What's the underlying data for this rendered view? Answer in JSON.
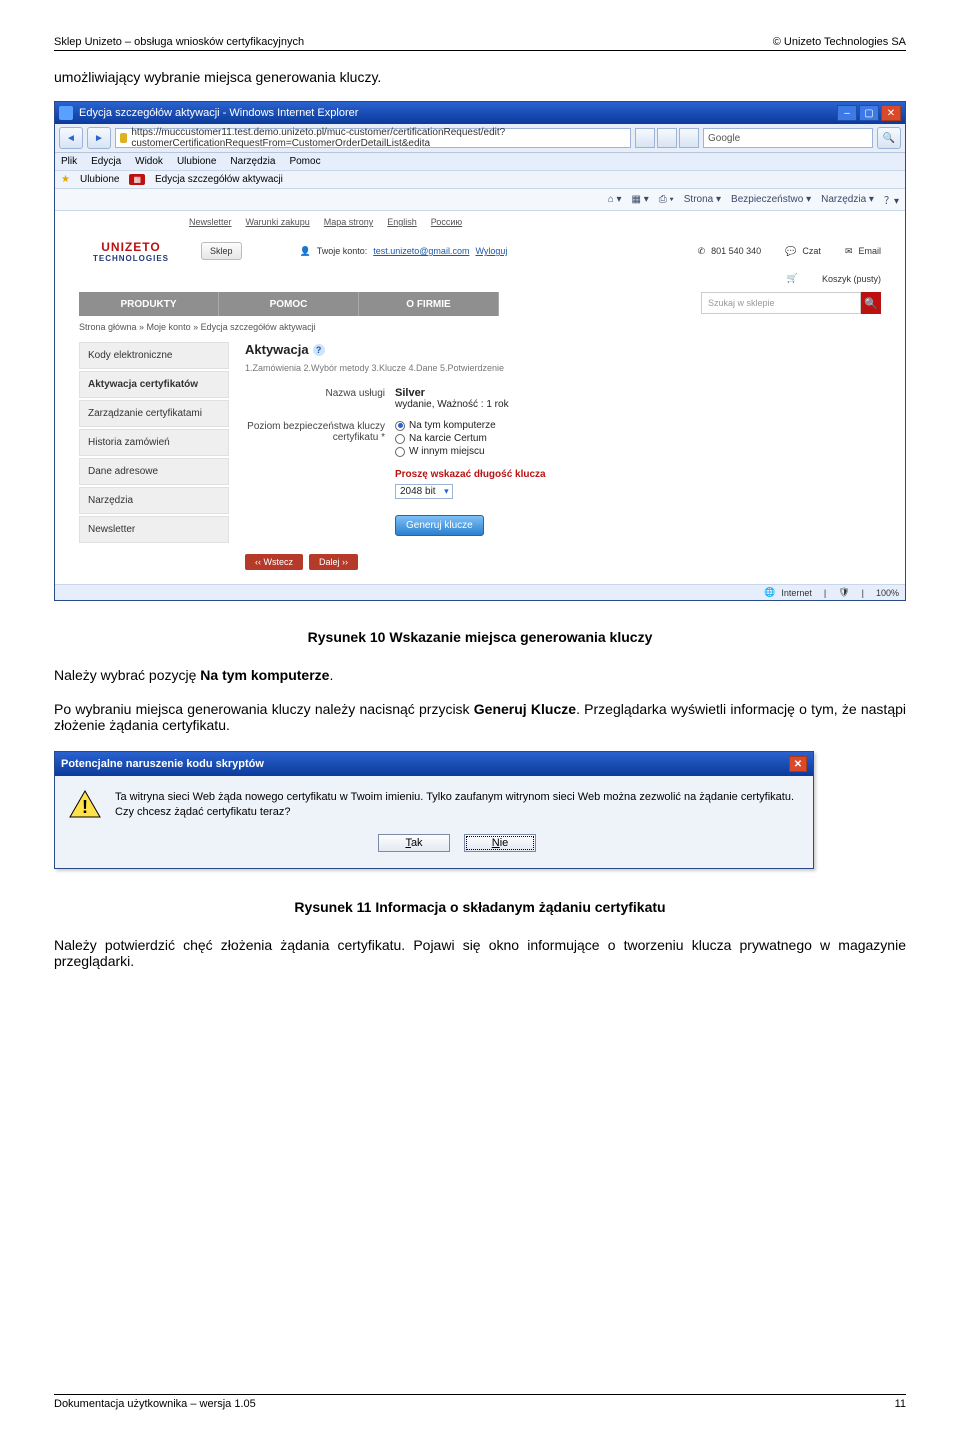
{
  "doc": {
    "header_left": "Sklep Unizeto – obsługa wniosków certyfikacyjnych",
    "header_right": "© Unizeto Technologies SA",
    "footer_left": "Dokumentacja użytkownika – wersja 1.05",
    "footer_right": "11"
  },
  "intro": "umożliwiający wybranie miejsca generowania kluczy.",
  "browser": {
    "window_title": "Edycja szczegółów aktywacji - Windows Internet Explorer",
    "url": "https://muccustomer11.test.demo.unizeto.pl/muc-customer/certificationRequest/edit?customerCertificationRequestFrom=CustomerOrderDetailList&edita",
    "search_provider": "Google",
    "menus": [
      "Plik",
      "Edycja",
      "Widok",
      "Ulubione",
      "Narzędzia",
      "Pomoc"
    ],
    "fav_label": "Ulubione",
    "fav_tab": "Edycja szczegółów aktywacji",
    "cmd": [
      "Strona",
      "Bezpieczeństwo",
      "Narzędzia"
    ],
    "status_zone": "Internet",
    "status_zoom": "100%"
  },
  "site": {
    "top_links": [
      "Newsletter",
      "Warunki zakupu",
      "Mapa strony",
      "English",
      "Россию"
    ],
    "logo_brand": "UNIZETO",
    "logo_sub": "TECHNOLOGIES",
    "sklep_btn": "Sklep",
    "account_prefix": "Twoje konto:",
    "account_email": "test.unizeto@gmail.com",
    "logout": "Wyloguj",
    "phone": "801 540 340",
    "chat": "Czat",
    "email": "Email",
    "cart": "Koszyk (pusty)",
    "nav": [
      "PRODUKTY",
      "POMOC",
      "O FIRMIE"
    ],
    "search_placeholder": "Szukaj w sklepie",
    "breadcrumbs": "Strona główna » Moje konto » Edycja szczegółów aktywacji",
    "side": [
      "Kody elektroniczne",
      "Aktywacja certyfikatów",
      "Zarządzanie certyfikatami",
      "Historia zamówień",
      "Dane adresowe",
      "Narzędzia",
      "Newsletter"
    ],
    "panel": {
      "heading": "Aktywacja",
      "steps": "1.Zamówienia   2.Wybór metody   3.Klucze   4.Dane   5.Potwierdzenie",
      "service_label": "Nazwa usługi",
      "service_value": "Silver",
      "service_sub": "wydanie, Ważność : 1 rok",
      "level_label": "Poziom bezpieczeństwa kluczy certyfikatu *",
      "radios": [
        "Na tym komputerze",
        "Na karcie Certum",
        "W innym miejscu"
      ],
      "key_prompt": "Proszę wskazać długość klucza",
      "key_value": "2048 bit",
      "gen_button": "Generuj klucze",
      "back": "‹‹  Wstecz",
      "next": "Dalej  ››"
    }
  },
  "caption1": "Rysunek 10 Wskazanie miejsca generowania kluczy",
  "para1_a": "Należy wybrać pozycję ",
  "para1_b": "Na tym komputerze",
  "para1_c": ".",
  "para2_a": "Po wybraniu miejsca generowania kluczy należy nacisnąć przycisk ",
  "para2_b": "Generuj Klucze",
  "para2_c": ". Przeglądarka wyświetli informację o tym, że nastąpi złożenie żądania certyfikatu.",
  "dialog": {
    "title": "Potencjalne naruszenie kodu skryptów",
    "line1": "Ta witryna sieci Web żąda nowego certyfikatu w Twoim imieniu. Tylko zaufanym witrynom sieci Web można zezwolić na żądanie certyfikatu.",
    "line2": "Czy chcesz żądać certyfikatu teraz?",
    "yes": "Tak",
    "no": "Nie"
  },
  "caption2": "Rysunek 11 Informacja o składanym żądaniu certyfikatu",
  "para3": "Należy potwierdzić chęć złożenia żądania certyfikatu. Pojawi się okno informujące o tworzeniu klucza prywatnego w magazynie przeglądarki."
}
